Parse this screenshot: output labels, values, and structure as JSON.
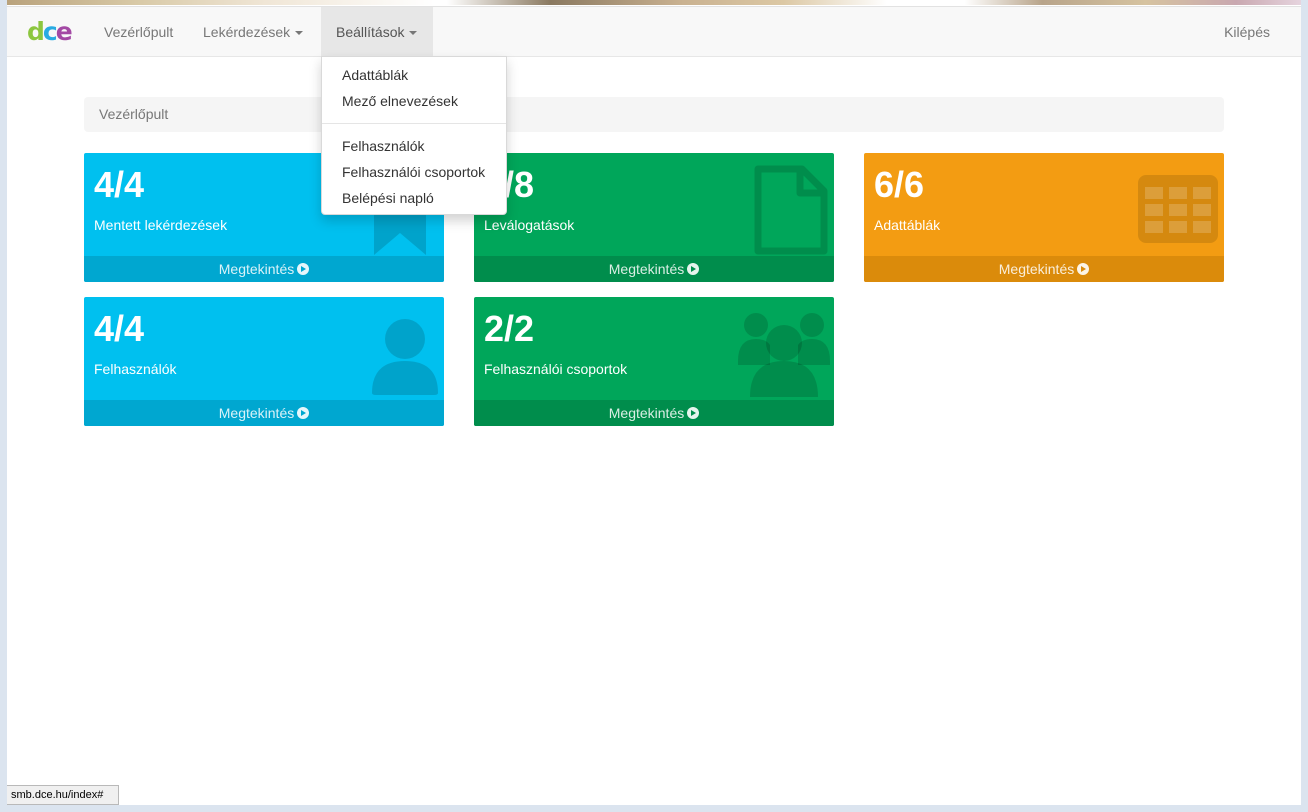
{
  "nav": {
    "items": [
      {
        "label": "Vezérlőpult"
      },
      {
        "label": "Lekérdezések"
      },
      {
        "label": "Beállítások"
      }
    ],
    "logout": "Kilépés"
  },
  "dropdown": {
    "group1": [
      "Adattáblák",
      "Mező elnevezések"
    ],
    "group2": [
      "Felhasználók",
      "Felhasználói csoportok",
      "Belépési napló"
    ]
  },
  "breadcrumb": "Vezérlőpult",
  "tiles": [
    {
      "count": "4/4",
      "label": "Mentett lekérdezések",
      "footer": "Megtekintés",
      "color": "#00c0ef",
      "icon": "bookmark-icon"
    },
    {
      "count": "8/8",
      "label": "Leválogatások",
      "footer": "Megtekintés",
      "color": "#00a65a",
      "icon": "file-icon"
    },
    {
      "count": "6/6",
      "label": "Adattáblák",
      "footer": "Megtekintés",
      "color": "#f39c12",
      "icon": "table-icon"
    },
    {
      "count": "4/4",
      "label": "Felhasználók",
      "footer": "Megtekintés",
      "color": "#00c0ef",
      "icon": "user-icon"
    },
    {
      "count": "2/2",
      "label": "Felhasználói csoportok",
      "footer": "Megtekintés",
      "color": "#00a65a",
      "icon": "users-icon"
    }
  ],
  "status_bar": "smb.dce.hu/index#"
}
